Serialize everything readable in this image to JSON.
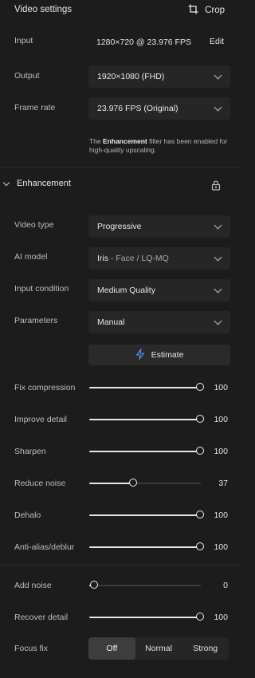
{
  "header": {
    "title": "Video settings",
    "crop_label": "Crop"
  },
  "input": {
    "label": "Input",
    "value": "1280×720 @ 23.976 FPS",
    "edit_label": "Edit"
  },
  "output": {
    "label": "Output",
    "value": "1920×1080 (FHD)"
  },
  "frame_rate": {
    "label": "Frame rate",
    "value": "23.976 FPS (Original)"
  },
  "note": {
    "prefix": "The ",
    "bold": "Enhancement",
    "suffix": " filter has been enabled for high-quality upscaling."
  },
  "enhancement": {
    "title": "Enhancement",
    "video_type": {
      "label": "Video type",
      "value": "Progressive"
    },
    "ai_model": {
      "label": "AI model",
      "name": "Iris",
      "variant": " - Face / LQ-MQ"
    },
    "input_condition": {
      "label": "Input condition",
      "value": "Medium Quality"
    },
    "parameters": {
      "label": "Parameters",
      "value": "Manual"
    },
    "estimate_label": "Estimate",
    "sliders": [
      {
        "label": "Fix compression",
        "value": 100
      },
      {
        "label": "Improve detail",
        "value": 100
      },
      {
        "label": "Sharpen",
        "value": 100
      },
      {
        "label": "Reduce noise",
        "value": 37
      },
      {
        "label": "Dehalo",
        "value": 100
      },
      {
        "label": "Anti-alias/deblur",
        "value": 100
      }
    ]
  },
  "grain": {
    "sliders": [
      {
        "label": "Add noise",
        "value": 0
      },
      {
        "label": "Recover detail",
        "value": 100
      }
    ]
  },
  "focus_fix": {
    "label": "Focus fix",
    "options": [
      "Off",
      "Normal",
      "Strong"
    ],
    "selected": "Off"
  },
  "colors": {
    "background": "#1c1c1c",
    "control": "#262626",
    "accent_icon": "#4f8fe6"
  }
}
